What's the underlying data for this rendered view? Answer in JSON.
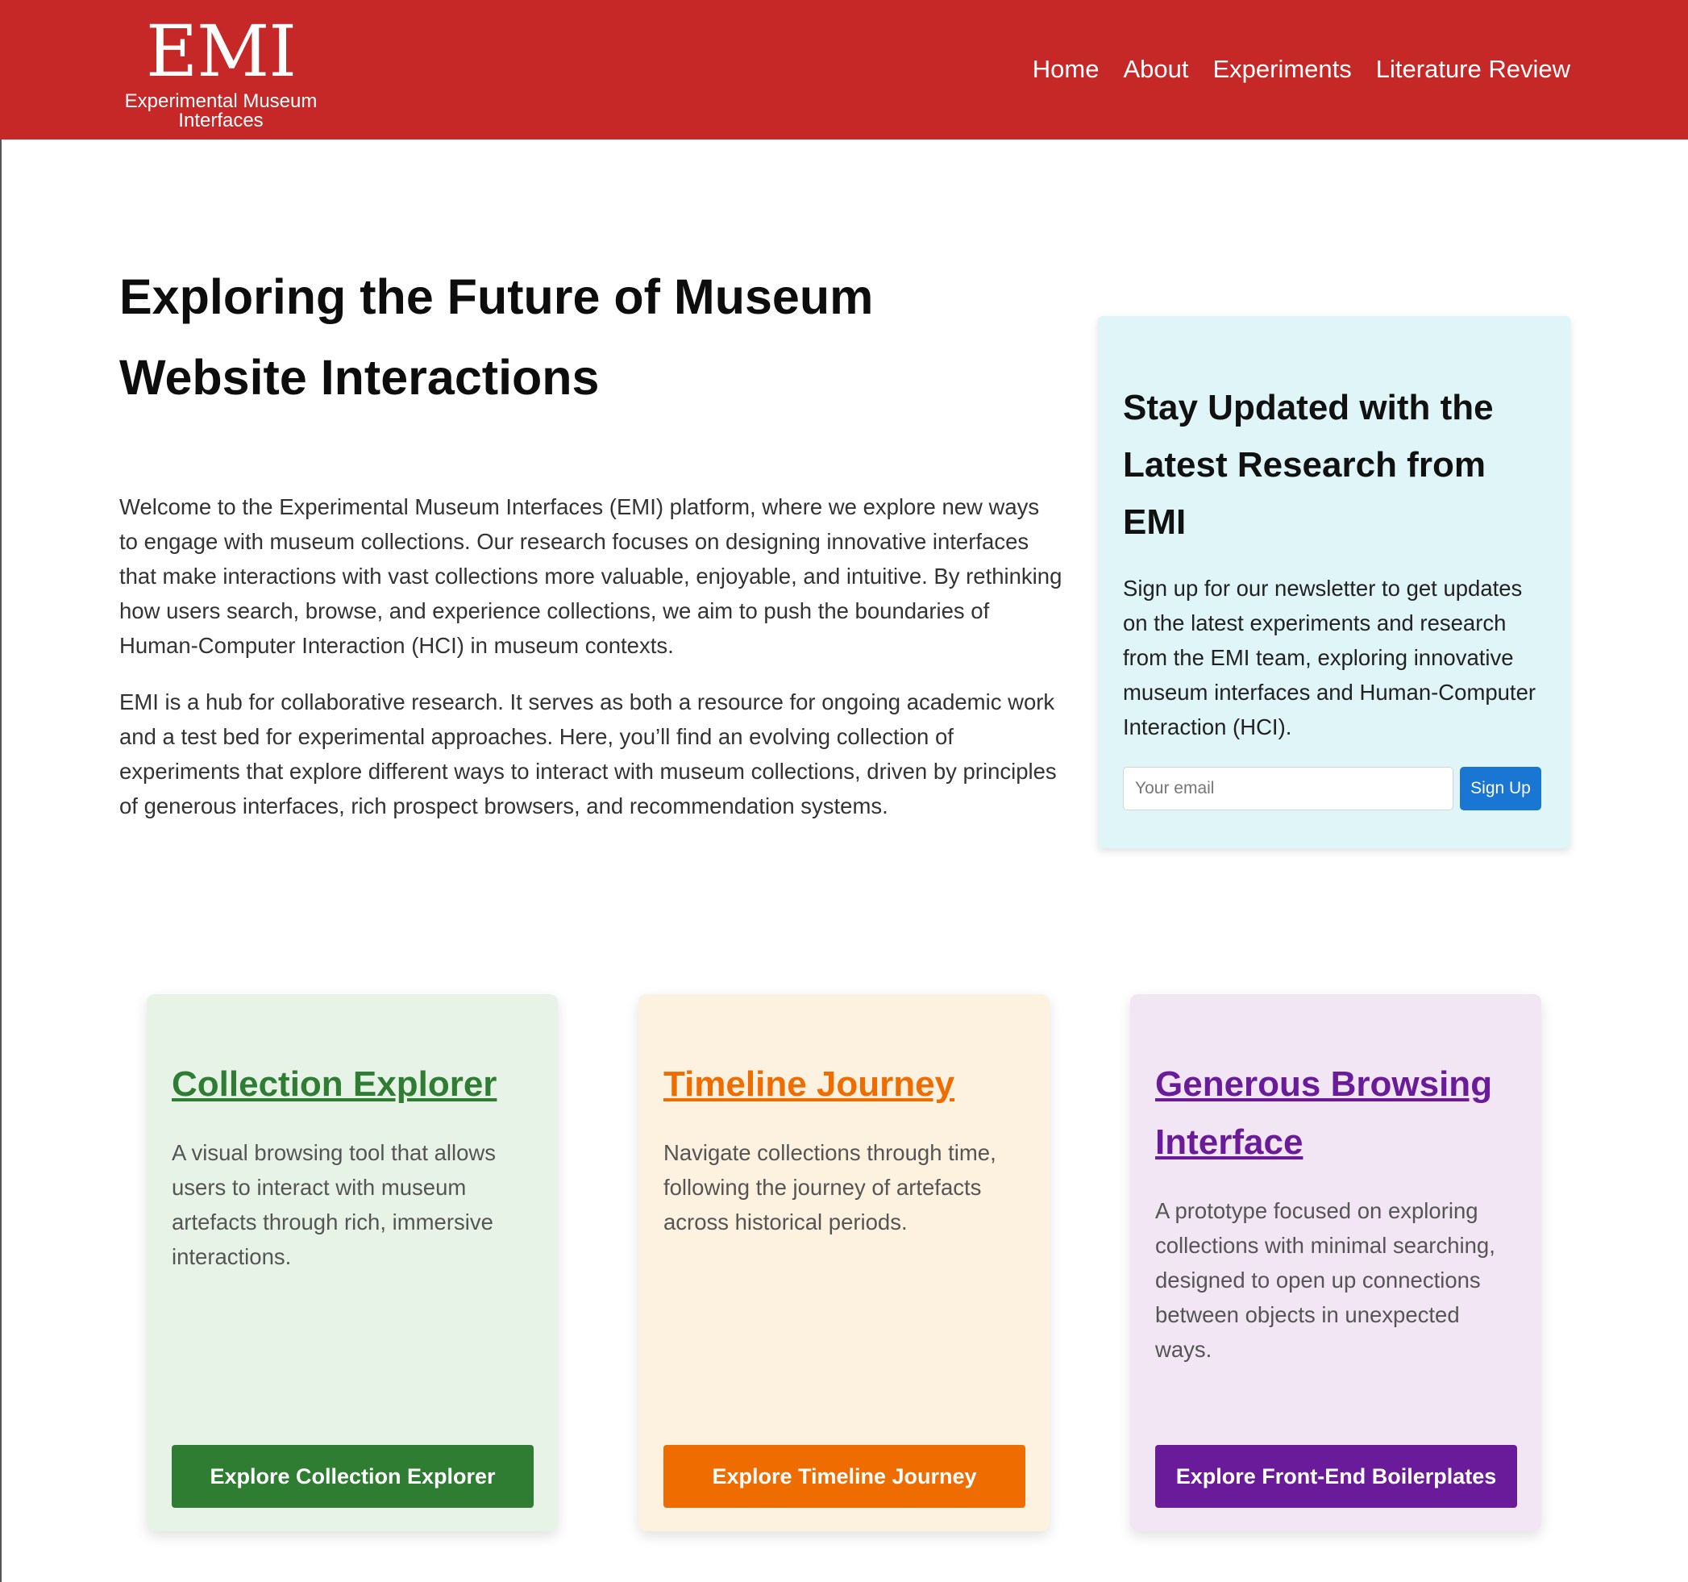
{
  "header": {
    "logo_mark": "EMI",
    "logo_subtitle": "Experimental Museum Interfaces",
    "nav": [
      {
        "label": "Home"
      },
      {
        "label": "About"
      },
      {
        "label": "Experiments"
      },
      {
        "label": "Literature Review"
      }
    ]
  },
  "hero": {
    "title": "Exploring the Future of Museum Website Interactions",
    "paragraphs": [
      "Welcome to the Experimental Museum Interfaces (EMI) platform, where we explore new ways to engage with museum collections. Our research focuses on designing innovative interfaces that make interactions with vast collections more valuable, enjoyable, and intuitive. By rethinking how users search, browse, and experience collections, we aim to push the boundaries of Human-Computer Interaction (HCI) in museum contexts.",
      "EMI is a hub for collaborative research. It serves as both a resource for ongoing academic work and a test bed for experimental approaches. Here, you’ll find an evolving collection of experiments that explore different ways to interact with museum collections, driven by principles of generous interfaces, rich prospect browsers, and recommendation systems."
    ]
  },
  "newsletter": {
    "title": "Stay Updated with the Latest Research from EMI",
    "text": "Sign up for our newsletter to get updates on the latest experiments and research from the EMI team, exploring innovative museum interfaces and Human-Computer Interaction (HCI).",
    "email_placeholder": "Your email",
    "email_value": "",
    "button_label": "Sign Up"
  },
  "cards": [
    {
      "title": "Collection Explorer",
      "description": "A visual browsing tool that allows users to interact with museum artefacts through rich, immersive interactions.",
      "button_label": "Explore Collection Explorer",
      "accent": "#2e7d32",
      "background": "#e8f3e8"
    },
    {
      "title": "Timeline Journey",
      "description": "Navigate collections through time, following the journey of artefacts across historical periods.",
      "button_label": "Explore Timeline Journey",
      "accent": "#ef6c00",
      "background": "#fdf1e0"
    },
    {
      "title": "Generous Browsing Interface",
      "description": "A prototype focused on exploring collections with minimal searching, designed to open up connections between objects in unexpected ways.",
      "button_label": "Explore Front-End Boilerplates",
      "accent": "#6a1b9a",
      "background": "#f2e5f4"
    }
  ],
  "colors": {
    "header_background": "#c62828",
    "newsletter_background": "#e0f5f7",
    "signup_button": "#1976d2"
  }
}
